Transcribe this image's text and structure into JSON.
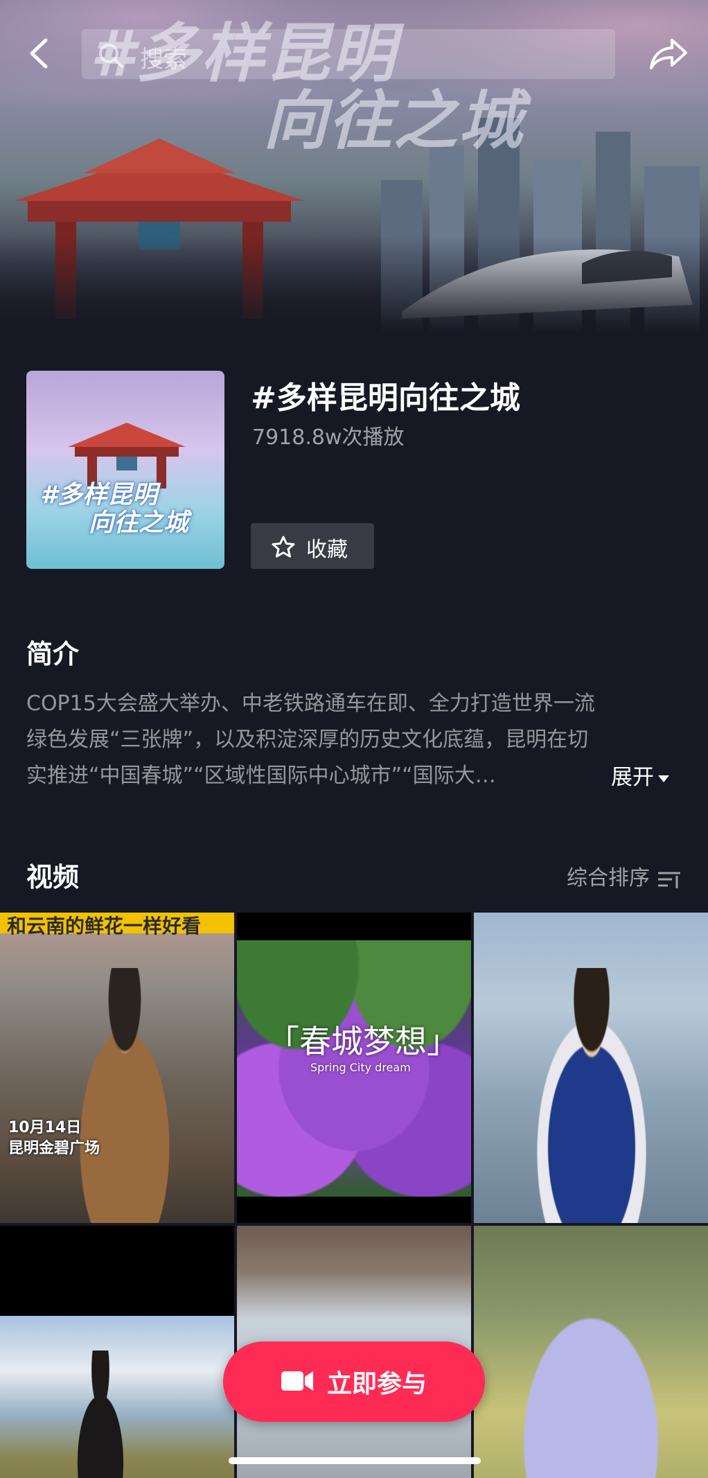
{
  "search": {
    "placeholder": "搜索"
  },
  "hero": {
    "title_line1": "#多样昆明",
    "title_line2": "向往之城"
  },
  "cover": {
    "line1": "#多样昆明",
    "line2": "向往之城"
  },
  "topic": {
    "title": "#多样昆明向往之城",
    "plays": "7918.8w次播放",
    "favorite_label": "收藏"
  },
  "intro": {
    "heading": "简介",
    "lines": [
      "COP15大会盛大举办、中老铁路通车在即、全力打造世界一流",
      "绿色发展“三张牌”，以及积淀深厚的历史文化底蕴，昆明在切",
      "实推进“中国春城”“区域性国际中心城市”“国际大…"
    ],
    "expand_label": "展开"
  },
  "videos": {
    "heading": "视频",
    "sort_label": "综合排序",
    "items": [
      {
        "banner": "和云南的鲜花一样好看",
        "caption_line1": "10月14日",
        "caption_line2": "昆明金碧广场"
      },
      {
        "title": "「春城梦想」",
        "subtitle": "Spring City dream"
      },
      {},
      {},
      {},
      {}
    ]
  },
  "join_button": {
    "label": "立即参与"
  },
  "colors": {
    "background": "#161823",
    "accent": "#fe2c55",
    "button_gray": "#393b44"
  }
}
